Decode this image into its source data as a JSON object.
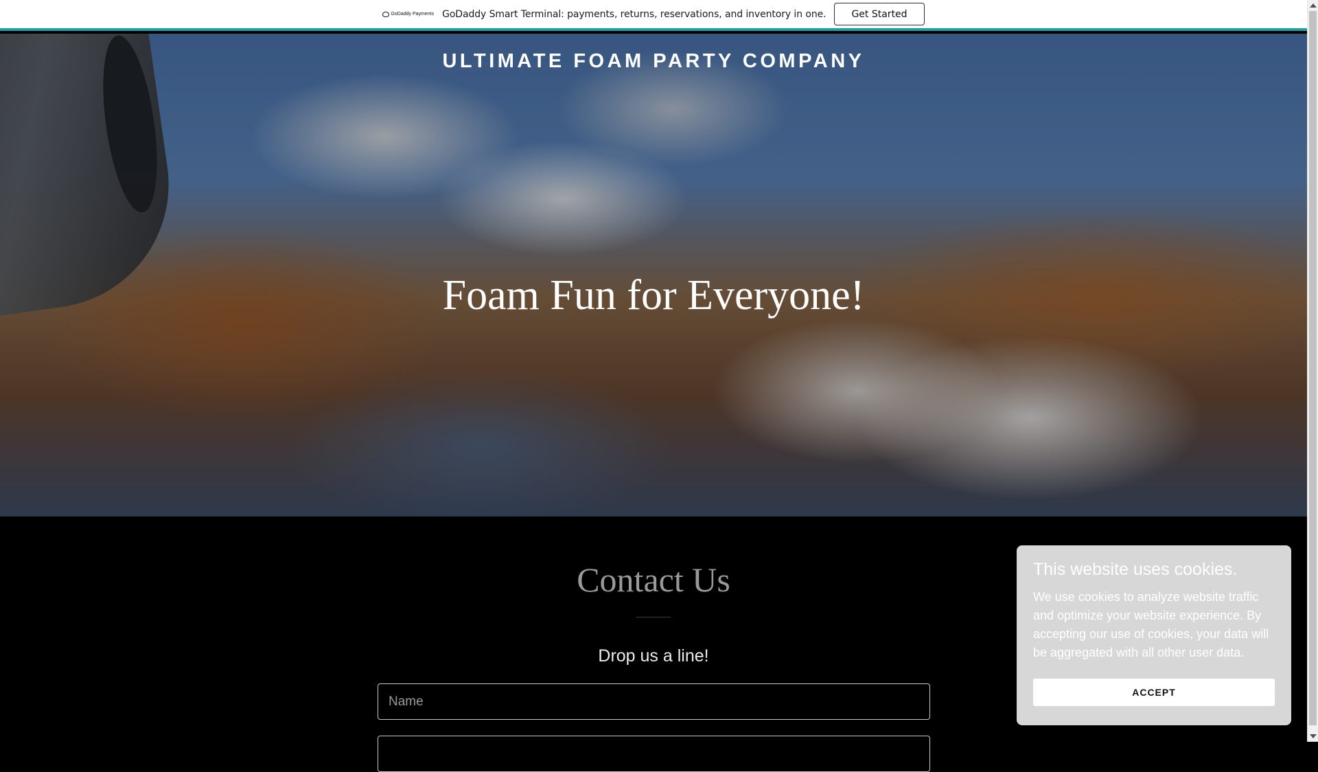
{
  "promo": {
    "logo_text": "GoDaddy Payments",
    "text": "GoDaddy Smart Terminal: payments, returns, reservations, and inventory in one.",
    "button_label": "Get Started"
  },
  "hero": {
    "site_title": "ULTIMATE FOAM PARTY COMPANY",
    "heading": "Foam Fun for Everyone!"
  },
  "contact": {
    "heading": "Contact Us",
    "subheading": "Drop us a line!",
    "name_placeholder": "Name"
  },
  "cookie": {
    "title": "This website uses cookies.",
    "body": "We use cookies to analyze website traffic and optimize your website experience. By accepting our use of cookies, your data will be aggregated with all other user data.",
    "accept_label": "ACCEPT"
  },
  "colors": {
    "promo_accent": "#1aa6a8",
    "page_background": "#000000",
    "cookie_panel": "#d7d7d7"
  }
}
